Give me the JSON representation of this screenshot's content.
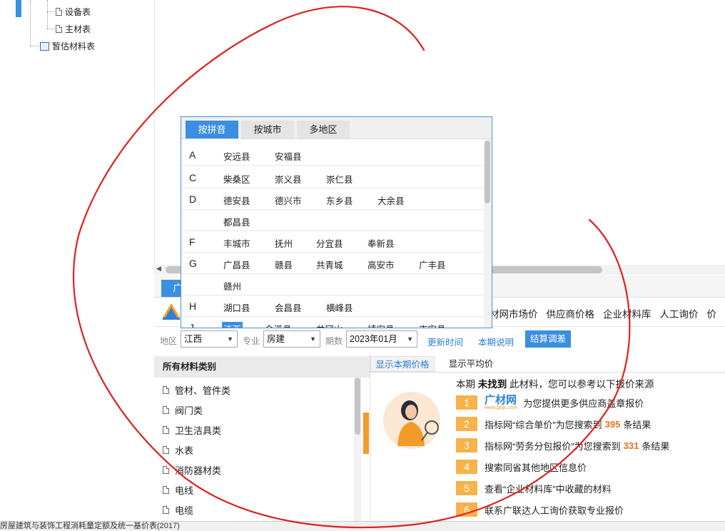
{
  "tree": {
    "items": [
      {
        "label": "设备表",
        "icon": "doc-icon"
      },
      {
        "label": "主材表",
        "icon": "doc-icon"
      },
      {
        "label": "暂估材料表",
        "icon": "table-icon"
      }
    ]
  },
  "bottom_tab": {
    "label": "广"
  },
  "nav": {
    "items": [
      "材网市场价",
      "供应商价格",
      "企业材料库",
      "人工询价",
      "价"
    ]
  },
  "filters": {
    "region_label": "地区",
    "region_value": "江西",
    "major_label": "专业",
    "major_value": "房建",
    "period_label": "期数",
    "period_value": "2023年01月",
    "update_time": "更新时间",
    "period_note": "本期说明",
    "settle_button": "结算调差"
  },
  "categories": {
    "header": "所有材料类别",
    "items": [
      "管材、管件类",
      "阀门类",
      "卫生洁具类",
      "水表",
      "消防器材类",
      "电线",
      "电缆"
    ]
  },
  "price_panel": {
    "tab_current": "显示本期价格",
    "tab_average": "显示平均价",
    "msg_prefix": "本期",
    "msg_not_found": "未找到",
    "msg_suffix": "此材料，您可以参考以下报价来源",
    "sources": [
      {
        "num": "1",
        "logo_text": "广材网",
        "logo_sub": "www.gldjc.com",
        "text": "为您提供更多供应商盖章报价"
      },
      {
        "num": "2",
        "pre": "指标网“综合单价”为您搜索到",
        "count": "395",
        "post": "条结果"
      },
      {
        "num": "3",
        "pre": "指标网“劳务分包报价”为您搜索到",
        "count": "331",
        "post": "条结果"
      },
      {
        "num": "4",
        "text": "搜索同省其他地区信息价"
      },
      {
        "num": "5",
        "text": "查看“企业材料库”中收藏的材料"
      },
      {
        "num": "6",
        "text": "联系广联达人工询价获取专业报价"
      }
    ]
  },
  "status_bar": {
    "text": "房屋建筑与装饰工程消耗量定额及统一基价表(2017)"
  },
  "popup": {
    "tabs": [
      "按拼音",
      "按城市",
      "多地区"
    ],
    "rows": [
      {
        "letter": "A",
        "counties": [
          "安远县",
          "安福县"
        ]
      },
      {
        "letter": "C",
        "counties": [
          "柴桑区",
          "崇义县",
          "崇仁县"
        ]
      },
      {
        "letter": "D",
        "counties": [
          "德安县",
          "德兴市",
          "东乡县",
          "大余县"
        ]
      },
      {
        "letter": "",
        "counties": [
          "都昌县"
        ]
      },
      {
        "letter": "F",
        "counties": [
          "丰城市",
          "抚州",
          "分宜县",
          "奉新县"
        ]
      },
      {
        "letter": "G",
        "counties": [
          "广昌县",
          "赣县",
          "共青城",
          "高安市",
          "广丰县"
        ]
      },
      {
        "letter": "",
        "counties": [
          "赣州"
        ]
      },
      {
        "letter": "H",
        "counties": [
          "湖口县",
          "会昌县",
          "横峰县"
        ]
      },
      {
        "letter": "J",
        "counties": [
          "江西",
          "金溪县",
          "井冈山",
          "靖安县",
          "吉安县"
        ]
      }
    ]
  },
  "colors": {
    "accent": "#3b8fe0",
    "orange": "#f7b24a",
    "highlight": "#e8721c",
    "scribble": "#e02020"
  }
}
